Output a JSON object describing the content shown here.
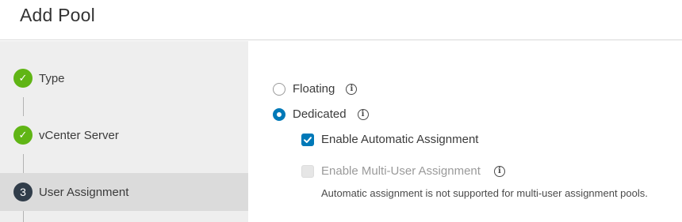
{
  "header": {
    "title": "Add Pool"
  },
  "wizard": {
    "steps": [
      {
        "label": "Type",
        "state": "done",
        "marker": "✓"
      },
      {
        "label": "vCenter Server",
        "state": "done",
        "marker": "✓"
      },
      {
        "label": "User Assignment",
        "state": "current",
        "marker": "3"
      }
    ]
  },
  "assignment": {
    "floating_label": "Floating",
    "dedicated_label": "Dedicated",
    "selected": "Dedicated",
    "auto_assign_label": "Enable Automatic Assignment",
    "auto_assign_checked": true,
    "multi_user_label": "Enable Multi-User Assignment",
    "multi_user_checked": false,
    "multi_user_disabled": true,
    "note": "Automatic assignment is not supported for multi-user assignment pools.",
    "info_glyph": "i"
  },
  "colors": {
    "accent": "#0079b8",
    "success": "#60b515",
    "current_step": "#313d4a",
    "sidebar_bg": "#eeeeee",
    "active_step_bg": "#dbdbdb"
  }
}
